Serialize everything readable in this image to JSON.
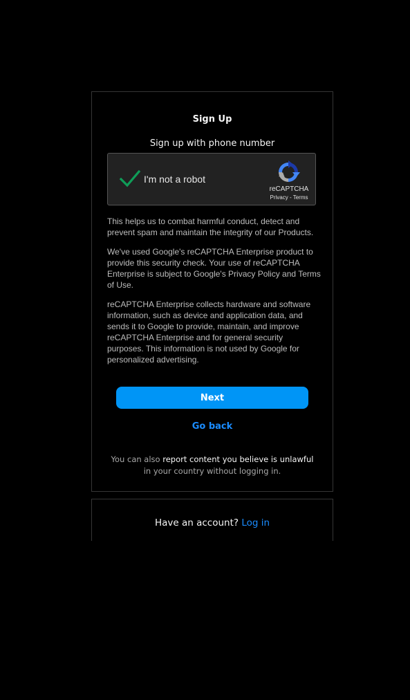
{
  "signup": {
    "title": "Sign Up",
    "subtitle": "Sign up with phone number"
  },
  "recaptcha": {
    "checkbox_label": "I'm not a robot",
    "brand": "reCAPTCHA",
    "privacy_link": "Privacy",
    "separator": " - ",
    "terms_link": "Terms",
    "checked": true,
    "check_color": "#0f9d58"
  },
  "info": {
    "paragraph1": "This helps us to combat harmful conduct, detect and prevent spam and maintain the integrity of our Products.",
    "paragraph2": "We've used Google's reCAPTCHA Enterprise product to provide this security check. Your use of reCAPTCHA Enterprise is subject to Google's Privacy Policy and Terms of Use.",
    "paragraph3": "reCAPTCHA Enterprise collects hardware and software information, such as device and application data, and sends it to Google to provide, maintain, and improve reCAPTCHA Enterprise and for general security purposes. This information is not used by Google for personalized advertising."
  },
  "actions": {
    "next_label": "Next",
    "go_back_label": "Go back"
  },
  "report": {
    "prefix": "You can also ",
    "link": "report content you believe is unlawful",
    "suffix": " in your country without logging in."
  },
  "account": {
    "prompt": "Have an account? ",
    "login_label": "Log in"
  },
  "colors": {
    "background": "#000000",
    "primary_button": "#0095f6",
    "link": "#1a8cff",
    "border": "#363636"
  }
}
